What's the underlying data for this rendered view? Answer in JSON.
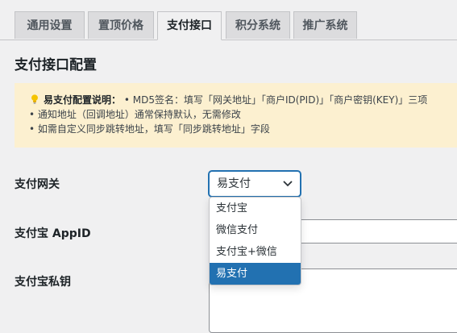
{
  "tabs": [
    {
      "label": "通用设置"
    },
    {
      "label": "置顶价格"
    },
    {
      "label": "支付接口"
    },
    {
      "label": "积分系统"
    },
    {
      "label": "推广系统"
    }
  ],
  "active_tab": "支付接口",
  "page": {
    "section_title": "支付接口配置"
  },
  "notice": {
    "icon": "lightbulb-icon",
    "title": "易支付配置说明：",
    "line1": "• MD5签名：填写「网关地址」「商户ID(PID)」「商户密钥(KEY)」三项",
    "line2": "• 通知地址（回调地址）通常保持默认，无需修改",
    "line3": "• 如需自定义同步跳转地址，填写「同步跳转地址」字段"
  },
  "fields": {
    "gateway_label": "支付网关",
    "appid_label": "支付宝 AppID",
    "privkey_label": "支付宝私钥"
  },
  "gateway_select": {
    "value": "易支付",
    "options": [
      "支付宝",
      "微信支付",
      "支付宝+微信",
      "易支付"
    ],
    "selected_index": 3
  },
  "colors": {
    "accent": "#2271b1",
    "notice_bg": "#fcf0d0",
    "page_bg": "#f0f0f1"
  }
}
